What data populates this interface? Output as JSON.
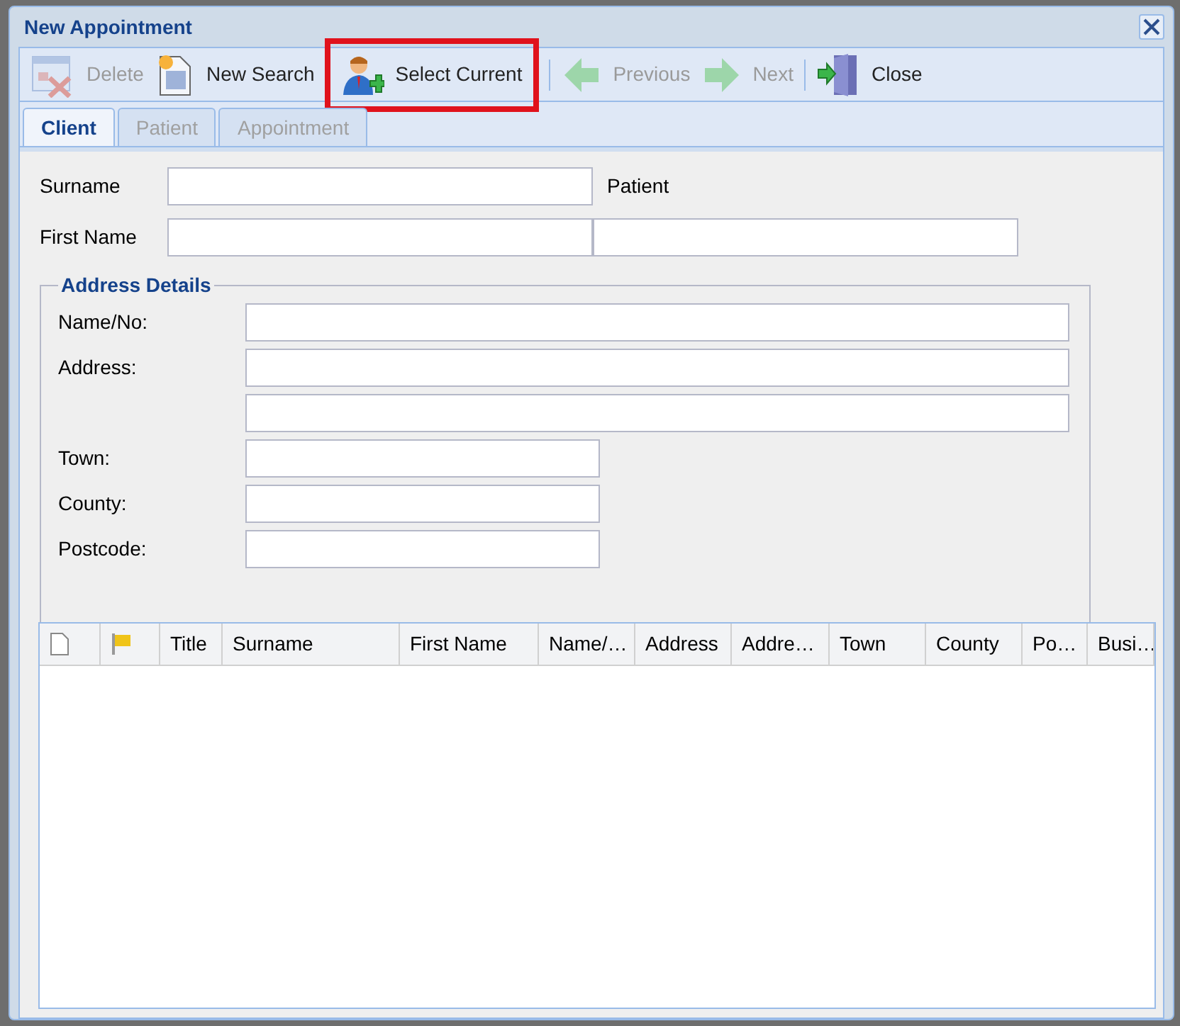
{
  "window": {
    "title": "New Appointment"
  },
  "toolbar": [
    {
      "kind": "delete",
      "label": "Delete",
      "disabled": true,
      "highlighted": false
    },
    {
      "kind": "search",
      "label": "New Search",
      "disabled": false,
      "highlighted": false
    },
    {
      "kind": "select",
      "label": "Select Current",
      "disabled": false,
      "highlighted": true
    },
    {
      "kind": "previous",
      "label": "Previous",
      "disabled": true,
      "highlighted": false
    },
    {
      "kind": "next",
      "label": "Next",
      "disabled": true,
      "highlighted": false
    },
    {
      "kind": "close",
      "label": "Close",
      "disabled": false,
      "highlighted": false
    }
  ],
  "tabs": [
    {
      "label": "Client",
      "selected": true,
      "disabled": false
    },
    {
      "label": "Patient",
      "selected": false,
      "disabled": true
    },
    {
      "label": "Appointment",
      "selected": false,
      "disabled": true
    }
  ],
  "client": {
    "surname_label": "Surname",
    "first_name_label": "First Name",
    "patient_label": "Patient"
  },
  "address": {
    "legend": "Address Details",
    "fields": [
      {
        "label": "Name/No:",
        "wide": true
      },
      {
        "label": "Address:",
        "wide": true
      },
      {
        "wide": true
      },
      {
        "label": "Town:",
        "wide": false
      },
      {
        "label": "County:",
        "wide": false
      },
      {
        "label": "Postcode:",
        "wide": false
      }
    ]
  },
  "grid": {
    "columns": [
      {
        "kind": "doc-icon"
      },
      {
        "kind": "flag-icon"
      },
      {
        "kind": "text",
        "label": "Title"
      },
      {
        "kind": "text",
        "label": "Surname"
      },
      {
        "kind": "text",
        "label": "First Name"
      },
      {
        "kind": "text",
        "label": "Name/…"
      },
      {
        "kind": "text",
        "label": "Address"
      },
      {
        "kind": "text",
        "label": "Addre…"
      },
      {
        "kind": "text",
        "label": "Town"
      },
      {
        "kind": "text",
        "label": "County"
      },
      {
        "kind": "text",
        "label": "Po…"
      },
      {
        "kind": "text",
        "label": "Busi…"
      }
    ]
  }
}
